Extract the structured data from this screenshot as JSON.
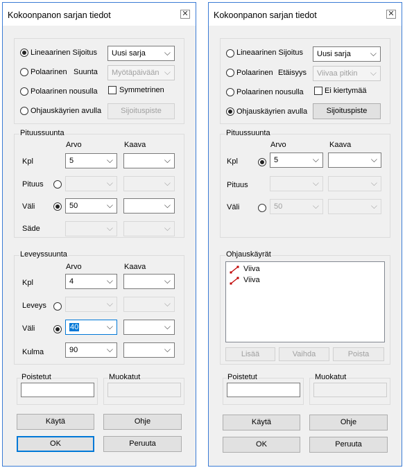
{
  "left": {
    "title": "Kokoonpanon sarjan tiedot",
    "radios": {
      "linear": "Lineaarinen Sijoitus",
      "polar": "Polaarinen",
      "polar_sub": "Suunta",
      "polar_up": "Polaarinen nousulla",
      "guide": "Ohjauskäyrien avulla"
    },
    "combo_type": "Uusi sarja",
    "combo_dir": "Myötäpäivään",
    "symmetric": "Symmetrinen",
    "placement_btn": "Sijoituspiste",
    "length": {
      "legend": "Pituussuunta",
      "col_value": "Arvo",
      "col_formula": "Kaava",
      "kpl": "Kpl",
      "kpl_value": "5",
      "pituus": "Pituus",
      "vali": "Väli",
      "vali_value": "50",
      "sade": "Säde"
    },
    "width": {
      "legend": "Leveyssuunta",
      "col_value": "Arvo",
      "col_formula": "Kaava",
      "kpl": "Kpl",
      "kpl_value": "4",
      "leveys": "Leveys",
      "vali": "Väli",
      "vali_value": "40",
      "kulma": "Kulma",
      "kulma_value": "90"
    },
    "removed": "Poistetut",
    "modified": "Muokatut",
    "apply": "Käytä",
    "help": "Ohje",
    "ok": "OK",
    "cancel": "Peruuta"
  },
  "right": {
    "title": "Kokoonpanon sarjan tiedot",
    "radios": {
      "linear": "Lineaarinen Sijoitus",
      "polar": "Polaarinen",
      "polar_sub": "Etäisyys",
      "polar_up": "Polaarinen nousulla",
      "guide": "Ohjauskäyrien avulla"
    },
    "combo_type": "Uusi sarja",
    "combo_dist": "Viivaa pitkin",
    "no_rotation": "Ei kiertymää",
    "placement_btn": "Sijoituspiste",
    "length": {
      "legend": "Pituussuunta",
      "col_value": "Arvo",
      "col_formula": "Kaava",
      "kpl": "Kpl",
      "kpl_value": "5",
      "pituus": "Pituus",
      "vali": "Väli",
      "vali_value": "50"
    },
    "guides": {
      "legend": "Ohjauskäyrät",
      "items": [
        "Viiva",
        "Viiva"
      ],
      "item_icon": "line-curve-icon",
      "add": "Lisää",
      "change": "Vaihda",
      "delete": "Poista"
    },
    "removed": "Poistetut",
    "modified": "Muokatut",
    "apply": "Käytä",
    "help": "Ohje",
    "ok": "OK",
    "cancel": "Peruuta"
  },
  "colors": {
    "accent": "#0078d7",
    "window_border": "#3a7bd5",
    "dialog_bg": "#f0f0f0",
    "curve_icon": "#c00000"
  }
}
